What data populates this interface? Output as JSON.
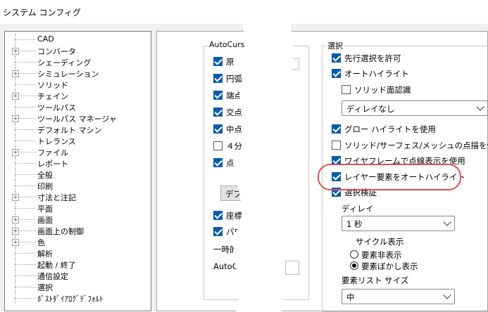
{
  "window": {
    "title": "システム コンフィグ"
  },
  "tree": {
    "items": [
      {
        "label": "CAD",
        "expandable": false
      },
      {
        "label": "コンバータ",
        "expandable": true
      },
      {
        "label": "シェーディング",
        "expandable": false
      },
      {
        "label": "シミュレーション",
        "expandable": true
      },
      {
        "label": "ソリッド",
        "expandable": false
      },
      {
        "label": "チェイン",
        "expandable": true
      },
      {
        "label": "ツールパス",
        "expandable": false
      },
      {
        "label": "ツールパス マネージャ",
        "expandable": true
      },
      {
        "label": "デフォルト マシン",
        "expandable": false
      },
      {
        "label": "トレランス",
        "expandable": false
      },
      {
        "label": "ファイル",
        "expandable": true
      },
      {
        "label": "レポート",
        "expandable": false
      },
      {
        "label": "全般",
        "expandable": false
      },
      {
        "label": "印刷",
        "expandable": false
      },
      {
        "label": "寸法と注記",
        "expandable": true
      },
      {
        "label": "平面",
        "expandable": false
      },
      {
        "label": "画面",
        "expandable": true
      },
      {
        "label": "画面上の制御",
        "expandable": true
      },
      {
        "label": "色",
        "expandable": true
      },
      {
        "label": "解析",
        "expandable": false
      },
      {
        "label": "起動 / 終了",
        "expandable": false
      },
      {
        "label": "通信設定",
        "expandable": false
      },
      {
        "label": "選択",
        "expandable": false
      },
      {
        "label": "ﾎﾟｽﾄﾀﾞｲｱﾛｸﾞﾃﾞﾌｫﾙﾄ",
        "expandable": false
      }
    ]
  },
  "autocursor": {
    "group_title": "AutoCurs",
    "items": [
      {
        "label": "原",
        "checked": true
      },
      {
        "label": "円弧",
        "checked": true
      },
      {
        "label": "端点",
        "checked": true
      },
      {
        "label": "交点",
        "checked": true
      },
      {
        "label": "中点",
        "checked": true
      },
      {
        "label": "４分",
        "checked": false
      },
      {
        "label": "点",
        "checked": true
      }
    ],
    "default_button": "デフ",
    "items2": [
      {
        "label": "座標",
        "checked": true
      },
      {
        "label": "パワー",
        "checked": true
      }
    ],
    "temp_label": "一時的な中",
    "autocursor_label": "AutoCurso"
  },
  "selection": {
    "group_title": "選択",
    "options": [
      {
        "label": "先行選択を許可",
        "checked": true
      },
      {
        "label": "オートハイライト",
        "checked": true
      },
      {
        "label": "ソリッド面認識",
        "checked": false
      }
    ],
    "delay_select": "ディレイなし",
    "options2": [
      {
        "label": "グロー ハイライトを使用",
        "checked": true
      },
      {
        "label": "ソリッド/サーフェス/メッシュの点描を使用",
        "checked": false
      },
      {
        "label": "ワイヤフレームで点線表示を使用",
        "checked": true
      },
      {
        "label": "レイヤー要素をオートハイライト",
        "checked": true
      },
      {
        "label": "選択検証",
        "checked": true
      }
    ],
    "delay_label": "ディレイ",
    "delay_value": "1 秒",
    "cycle_label": "サイクル表示",
    "radios": [
      {
        "label": "要素非表示",
        "selected": false
      },
      {
        "label": "要素ぼかし表示",
        "selected": true
      }
    ],
    "list_size_label": "要素リスト サイズ",
    "list_size_value": "中"
  },
  "colors": {
    "accent": "#0b5cad",
    "highlight": "#d9534f"
  }
}
